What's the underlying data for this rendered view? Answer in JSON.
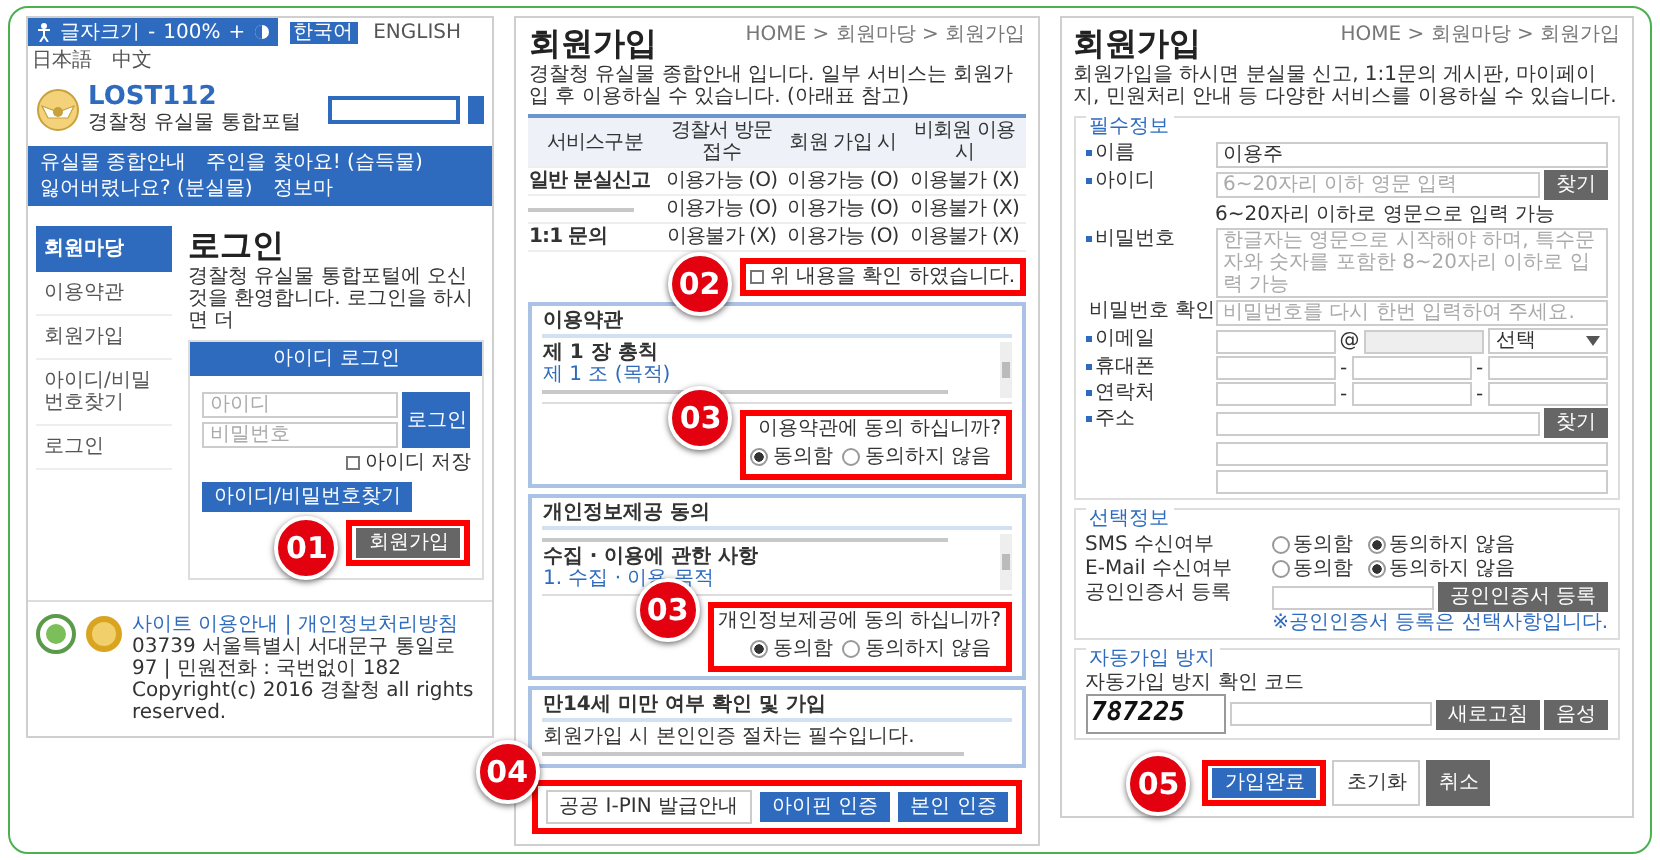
{
  "login_page": {
    "top_bar": {
      "label": "글자크기",
      "minus": "-",
      "zoom": "100%",
      "plus": "+",
      "languages": [
        {
          "label": "한국어",
          "selected": true
        },
        {
          "label": "ENGLISH",
          "selected": false
        },
        {
          "label": "日本語",
          "selected": false
        },
        {
          "label": "中文",
          "selected": false
        }
      ]
    },
    "logo": {
      "title": "LOST112",
      "subtitle": "경찰청 유실물 통합포털"
    },
    "nav": [
      "유실물 종합안내",
      "주인을 찾아요! (습득물)",
      "잃어버렸나요? (분실물)",
      "정보마"
    ],
    "sidebar": {
      "title": "회원마당",
      "items": [
        "이용약관",
        "회원가입",
        "아이디/비밀번호찾기",
        "로그인"
      ]
    },
    "title": "로그인",
    "description": "경찰청 유실물 통합포털에 오신 것을 환영합니다. 로그인을 하시면 더",
    "login_tab": "아이디 로그인",
    "id_placeholder": "아이디",
    "pw_placeholder": "비밀번호",
    "login_button": "로그인",
    "save_id": {
      "label": "아이디 저장",
      "checked": false
    },
    "find_button": "아이디/비밀번호찾기",
    "signup_button": {
      "label": "회원가입",
      "badge": "01"
    },
    "footer": {
      "links": "사이트 이용안내 | 개인정보처리방침",
      "lines": [
        "03739 서울특별시 서대문구 통일로 97 | 민원전화 : 국번없이 182",
        "Copyright(c) 2016 경찰청 all rights reserved."
      ]
    }
  },
  "terms_page": {
    "breadcrumb": "HOME > 회원마당 > 회원가입",
    "title": "회원가입",
    "description": "경찰청 유실물 종합안내 입니다. 일부 서비스는 회원가입 후 이용하실 수 있습니다. (아래표 참고)",
    "table": {
      "columns": [
        "서비스구분",
        "경찰서 방문 접수",
        "회원 가입 시",
        "비회원 이용 시"
      ],
      "rows": [
        {
          "cells": [
            "일반 분실신고",
            "이용가능 (O)",
            "이용가능 (O)",
            "이용불가 (X)"
          ]
        },
        {
          "cells": [
            "",
            "이용가능 (O)",
            "이용가능 (O)",
            "이용불가 (X)"
          ]
        },
        {
          "cells": [
            "1:1 문의",
            "이용불가 (X)",
            "이용가능 (O)",
            "이용불가 (X)"
          ]
        }
      ]
    },
    "confirm": {
      "label": "위 내용을 확인 하였습니다.",
      "checked": false,
      "badge": "02"
    },
    "sections": [
      {
        "kind": "terms",
        "title": "이용약관",
        "lines": [
          {
            "kind": "heading",
            "text": "제 1 장 총칙"
          },
          {
            "kind": "link",
            "text": "제 1 조 (목적)"
          }
        ],
        "question": "이용약관에 동의 하십니까?",
        "options": [
          {
            "label": "동의함",
            "selected": true
          },
          {
            "label": "동의하지 않음",
            "selected": false
          }
        ],
        "badge": "03"
      },
      {
        "kind": "terms",
        "title": "개인정보제공 동의",
        "lines": [
          {
            "kind": "heading",
            "text": "수집 · 이용에 관한 사항"
          },
          {
            "kind": "link",
            "text": "1. 수집 · 이용 목적"
          }
        ],
        "question": "개인정보제공에 동의 하십니까?",
        "options": [
          {
            "label": "동의함",
            "selected": true
          },
          {
            "label": "동의하지 않음",
            "selected": false
          }
        ],
        "badge": "03"
      },
      {
        "kind": "info",
        "title": "만14세 미만 여부 확인 및 가입",
        "lines": [
          {
            "kind": "text",
            "text": "회원가입 시 본인인증 절차는 필수입니다."
          }
        ]
      }
    ],
    "buttons": [
      {
        "label": "공공 I-PIN 발급안내",
        "kind": "plain"
      },
      {
        "label": "아이핀 인증",
        "kind": "primary"
      },
      {
        "label": "본인 인증",
        "kind": "primary"
      }
    ],
    "buttons_badge": "04"
  },
  "form_page": {
    "breadcrumb": "HOME > 회원마당 > 회원가입",
    "title": "회원가입",
    "description": "회원가입을 하시면 분실물 신고, 1:1문의 게시판, 마이페이지, 민원처리 안내 등 다양한 서비스를 이용하실 수 있습니다.",
    "required": {
      "legend": "필수정보",
      "fields": [
        {
          "kind": "text",
          "label": "이름",
          "value": "이용주"
        },
        {
          "kind": "text",
          "label": "아이디",
          "placeholder": "6~20자리 이하 영문 입력",
          "button": "찾기",
          "note": "6~20자리 이하로 영문으로 입력 가능"
        },
        {
          "kind": "text",
          "label": "비밀번호",
          "placeholder": "한글자는 영문으로 시작해야 하며, 특수문자와 숫자를 포함한 8~20자리 이하로 입력 가능"
        },
        {
          "kind": "text",
          "label": "비밀번호 확인",
          "placeholder": "비밀번호를 다시 한번 입력하여 주세요."
        },
        {
          "kind": "email",
          "label": "이메일",
          "at": "@",
          "select": "선택"
        },
        {
          "kind": "phone",
          "label": "휴대폰",
          "separators": [
            "-",
            "-"
          ]
        },
        {
          "kind": "phone",
          "label": "연락처",
          "separators": [
            "-",
            "-"
          ]
        },
        {
          "kind": "address",
          "label": "주소",
          "button": "찾기"
        }
      ]
    },
    "optional": {
      "legend": "선택정보",
      "items": [
        {
          "kind": "radio",
          "label": "SMS 수신여부",
          "options": [
            {
              "label": "동의함",
              "selected": false
            },
            {
              "label": "동의하지 않음",
              "selected": true
            }
          ]
        },
        {
          "kind": "radio",
          "label": "E-Mail 수신여부",
          "options": [
            {
              "label": "동의함",
              "selected": false
            },
            {
              "label": "동의하지 않음",
              "selected": true
            }
          ]
        },
        {
          "kind": "cert",
          "label": "공인인증서 등록",
          "button": "공인인증서 등록",
          "note": "※공인인증서 등록은 선택사항입니다."
        }
      ]
    },
    "captcha": {
      "legend": "자동가입 방지",
      "label": "자동가입 방지 확인 코드",
      "code": "787225",
      "buttons": [
        "새로고침",
        "음성"
      ]
    },
    "buttons": [
      {
        "label": "가입완료",
        "kind": "primary",
        "badge": "05"
      },
      {
        "label": "초기화",
        "kind": "plain"
      },
      {
        "label": "취소",
        "kind": "dark"
      }
    ]
  }
}
